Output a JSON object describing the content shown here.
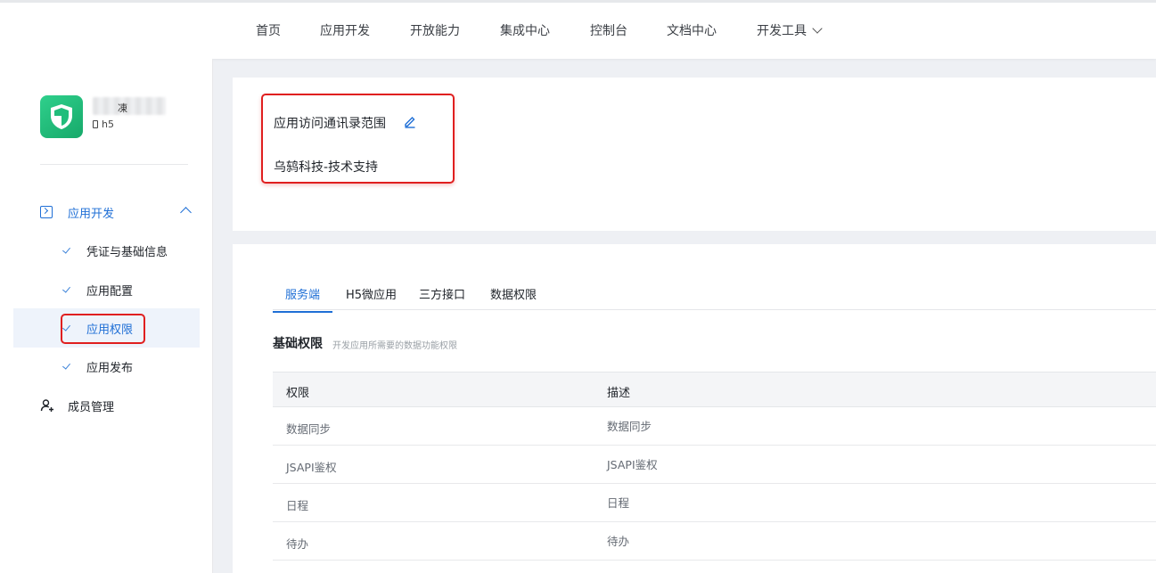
{
  "nav": {
    "items": [
      "首页",
      "应用开发",
      "开放能力",
      "集成中心",
      "控制台",
      "文档中心"
    ],
    "dev_tools": "开发工具"
  },
  "sidebar": {
    "app_name": "凍",
    "app_type": "h5",
    "group_label": "应用开发",
    "sub_items": [
      "凭证与基础信息",
      "应用配置",
      "应用权限",
      "应用发布"
    ],
    "active_item": "应用权限",
    "member_label": "成员管理"
  },
  "scope": {
    "label": "应用访问通讯录范围",
    "value": "乌鸫科技-技术支持"
  },
  "tabs": [
    "服务端",
    "H5微应用",
    "三方接口",
    "数据权限"
  ],
  "section": {
    "title": "基础权限",
    "subtitle": "开发应用所需要的数据功能权限"
  },
  "table": {
    "headers": [
      "权限",
      "描述"
    ],
    "rows": [
      [
        "数据同步",
        "数据同步"
      ],
      [
        "JSAPI鉴权",
        "JSAPI鉴权"
      ],
      [
        "日程",
        "日程"
      ],
      [
        "待办",
        "待办"
      ]
    ]
  },
  "colors": {
    "accent": "#1f6fd6",
    "highlight_border": "#e01f1f",
    "logo_green": "#21bd7b"
  }
}
